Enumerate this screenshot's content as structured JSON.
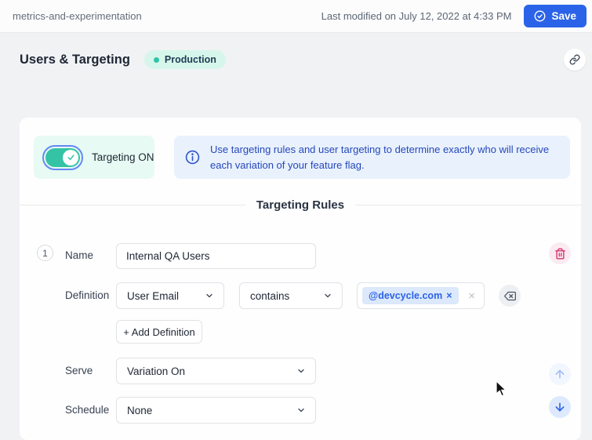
{
  "header": {
    "project_name": "metrics-and-experimentation",
    "last_modified": "Last modified on July 12, 2022 at 4:33 PM",
    "save_label": "Save"
  },
  "page": {
    "title": "Users & Targeting",
    "environment": "Production"
  },
  "targeting": {
    "toggle_label": "Targeting ON",
    "toggle_state": "on",
    "info_text": "Use targeting rules and user targeting to determine exactly who will receive each variation of your feature flag.",
    "rules_heading": "Targeting Rules"
  },
  "rule": {
    "index": "1",
    "name_label": "Name",
    "name_value": "Internal QA Users",
    "definition_label": "Definition",
    "property_selected": "User Email",
    "comparator_selected": "contains",
    "tag": "@devcycle.com",
    "add_definition_label": "+ Add Definition",
    "serve_label": "Serve",
    "serve_selected": "Variation On",
    "schedule_label": "Schedule",
    "schedule_selected": "None"
  },
  "icons": {
    "remove_tag_glyph": "×",
    "clear_input_glyph": "×"
  },
  "colors": {
    "accent_blue": "#2b63e8",
    "teal": "#33c3a6",
    "danger_pink": "#d6336c",
    "mint_bg": "#e7faf3",
    "info_bg": "#e9f1fd",
    "badge_bg": "#d7f6eb"
  }
}
